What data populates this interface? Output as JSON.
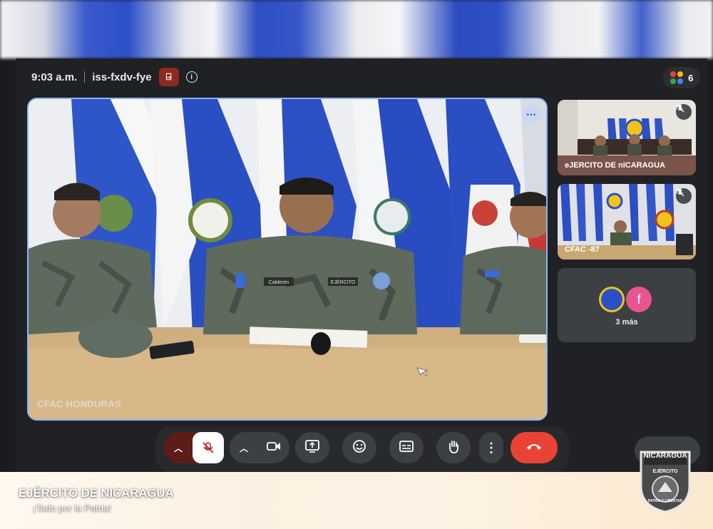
{
  "meeting": {
    "time": "9:03 a.m.",
    "code": "iss-fxdv-fye",
    "participant_count": "6"
  },
  "main_tile": {
    "name": "CFAC HONDURAS"
  },
  "side_tiles": [
    {
      "name": "eJERCITO DE nICARAGUA"
    },
    {
      "name": "CFAC -87"
    }
  ],
  "more_people": {
    "avatar_letter": "f",
    "label": "3 más"
  },
  "uniform_tags": [
    "Calderón",
    "EJÉRCITO"
  ],
  "branding": {
    "title": "EJÉRCITO DE NICARAGUA",
    "subtitle": "¡Todo por la Patria!",
    "emblem_top": "NICARAGUA",
    "emblem_mid": "EJÉRCITO",
    "emblem_motto": "PATRIA Y LIBERTAD"
  },
  "colors": {
    "accent": "#8ab4f8",
    "end_call": "#ea4335",
    "flag_blue": "#2d4fc4",
    "toolbar": "#3c4043"
  }
}
